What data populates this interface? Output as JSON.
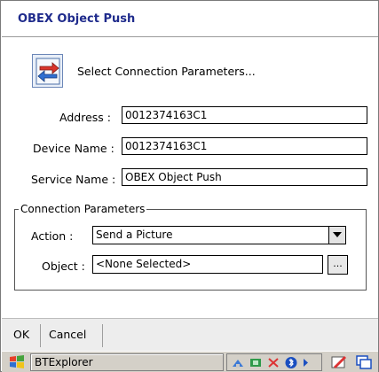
{
  "window": {
    "title": "OBEX Object Push"
  },
  "header": {
    "text": "Select Connection Parameters...",
    "icon": "transfer-icon"
  },
  "form": {
    "address": {
      "label": "Address :",
      "value": "0012374163C1"
    },
    "device_name": {
      "label": "Device Name :",
      "value": "0012374163C1"
    },
    "service_name": {
      "label": "Service Name :",
      "value": "OBEX Object Push"
    }
  },
  "connection": {
    "legend": "Connection Parameters",
    "action": {
      "label": "Action :",
      "value": "Send a Picture"
    },
    "object": {
      "label": "Object :",
      "value": "<None Selected>",
      "browse_label": "..."
    }
  },
  "menu": {
    "ok": "OK",
    "cancel": "Cancel"
  },
  "taskbar": {
    "app": "BTExplorer"
  },
  "colors": {
    "title": "#1f2b8c",
    "menubar": "#ededed",
    "taskbar": "#d4d0c8"
  }
}
